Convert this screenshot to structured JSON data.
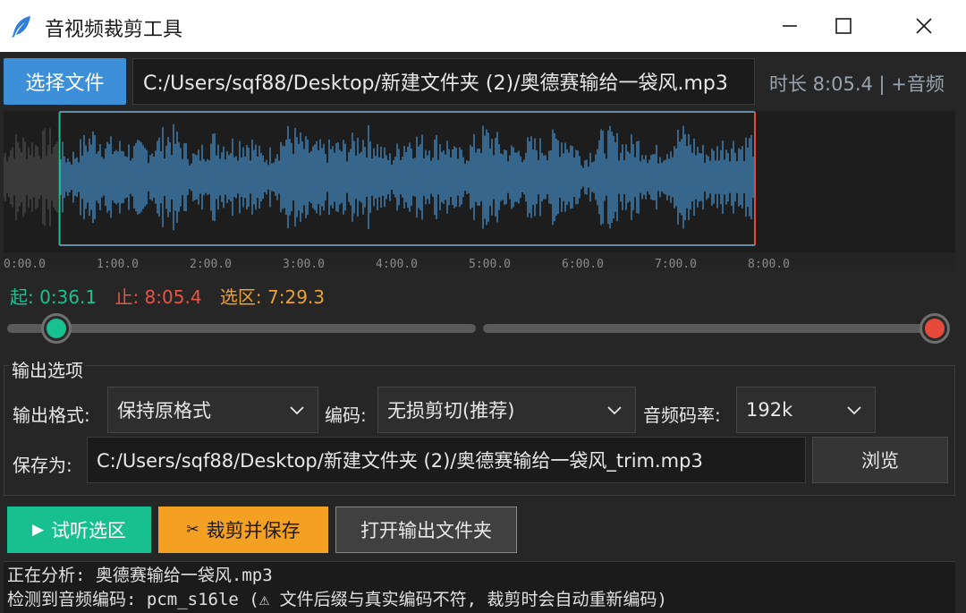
{
  "window": {
    "title": "音视频裁剪工具",
    "minimize_label": "—",
    "maximize_label": "☐",
    "close_label": "✕"
  },
  "file": {
    "select_button": "选择文件",
    "input_path": "C:/Users/sqf88/Desktop/新建文件夹 (2)/奥德赛输给一袋风.mp3",
    "duration_text": "时长 8:05.4 | +音频"
  },
  "waveform": {
    "time_labels": [
      "0:00.0",
      "1:00.0",
      "2:00.0",
      "3:00.0",
      "4:00.0",
      "5:00.0",
      "6:00.0",
      "7:00.0",
      "8:00.0"
    ],
    "total_seconds": 485.4,
    "selection_start_seconds": 36.1,
    "selection_end_seconds": 485.4,
    "wave_color": "#4b9fe0",
    "dim_wave_color": "#8a8a8a",
    "start_marker_color": "#19c191",
    "end_marker_color": "#e64a3a"
  },
  "range": {
    "start_text": "起: 0:36.1",
    "end_text": "止: 8:05.4",
    "selection_text": "选区: 7:29.3",
    "start_color": "#19c191",
    "end_color": "#e65545",
    "selection_color": "#e9a23a"
  },
  "sliders": {
    "start_fraction": 0.0744,
    "end_fraction": 1.0
  },
  "output": {
    "group_title": "输出选项",
    "format_label": "输出格式:",
    "format_value": "保持原格式",
    "codec_label": "编码:",
    "codec_value": "无损剪切(推荐)",
    "bitrate_label": "音频码率:",
    "bitrate_value": "192k",
    "save_label": "保存为:",
    "save_path": "C:/Users/sqf88/Desktop/新建文件夹 (2)/奥德赛输给一袋风_trim.mp3",
    "browse_button": "浏览"
  },
  "actions": {
    "preview_icon": "▶",
    "preview_label": "试听选区",
    "cut_icon": "✂",
    "cut_label": "裁剪并保存",
    "open_folder_label": "打开输出文件夹",
    "preview_color": "#18c08f",
    "cut_color": "#f4a022"
  },
  "log": {
    "lines": [
      "正在分析: 奥德赛输给一袋风.mp3",
      "检测到音频编码: pcm_s16le  (⚠ 文件后缀与真实编码不符, 裁剪时会自动重新编码)"
    ]
  }
}
